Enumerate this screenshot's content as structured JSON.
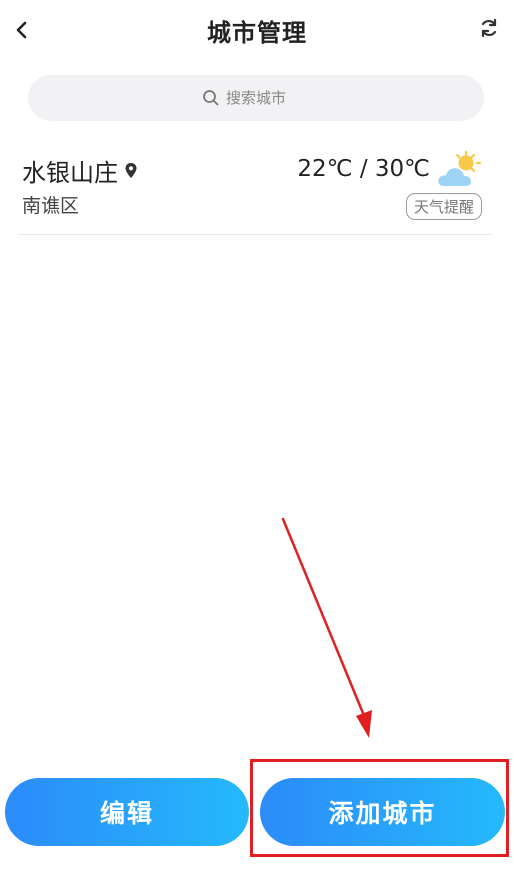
{
  "header": {
    "back_icon": "chevron-left-icon",
    "title": "城市管理",
    "refresh_icon": "refresh-icon"
  },
  "search": {
    "icon": "search-icon",
    "placeholder": "搜索城市"
  },
  "cities": [
    {
      "name": "水银山庄",
      "location_icon": "location-pin-icon",
      "district": "南谯区",
      "temperature": "22℃ / 30℃",
      "weather_icon": "partly-cloudy-icon",
      "remind_label": "天气提醒"
    }
  ],
  "buttons": {
    "edit_label": "编辑",
    "add_label": "添加城市"
  },
  "annotation": {
    "color": "#e02020",
    "target": "添加城市"
  },
  "colors": {
    "button_gradient_start": "#2b8bfa",
    "button_gradient_end": "#25b9fb",
    "sun": "#f7c948",
    "cloud": "#9ed3f5"
  }
}
